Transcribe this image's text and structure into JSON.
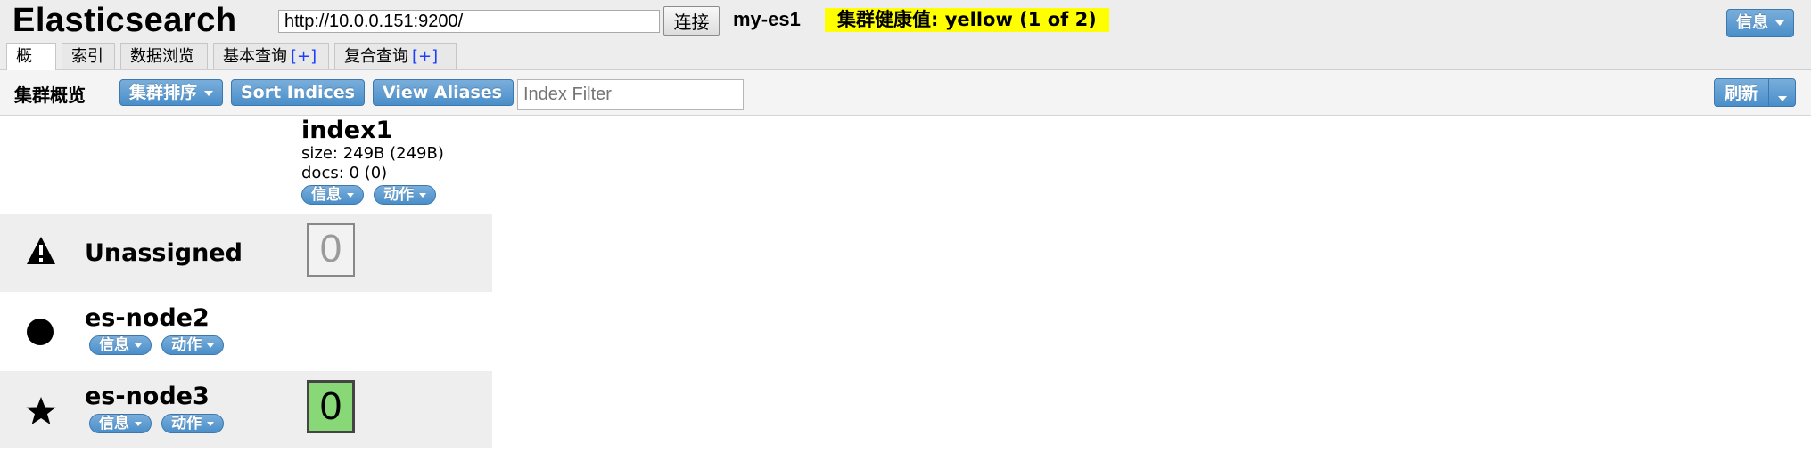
{
  "header": {
    "app_title": "Elasticsearch",
    "url_value": "http://10.0.0.151:9200/",
    "connect_label": "连接",
    "cluster_name": "my-es1",
    "health_text": "集群健康值: yellow (1 of 2)",
    "info_label": "信息"
  },
  "tabs": [
    {
      "label": "概览",
      "active": true
    },
    {
      "label": "索引",
      "active": false
    },
    {
      "label": "数据浏览",
      "active": false
    },
    {
      "label": "基本查询",
      "plus": "[+]",
      "active": false
    },
    {
      "label": "复合查询",
      "plus": "[+]",
      "active": false
    }
  ],
  "toolbar": {
    "title": "集群概览",
    "cluster_sort_label": "集群排序",
    "sort_indices_label": "Sort Indices",
    "view_aliases_label": "View Aliases",
    "index_filter_placeholder": "Index Filter",
    "refresh_label": "刷新"
  },
  "index": {
    "name": "index1",
    "size": "size: 249B (249B)",
    "docs": "docs: 0 (0)",
    "info_label": "信息",
    "action_label": "动作"
  },
  "rows": [
    {
      "name": "Unassigned",
      "icon": "warning-icon",
      "shard": "0"
    },
    {
      "name": "es-node2",
      "icon": "circle-icon",
      "info_label": "信息",
      "action_label": "动作"
    },
    {
      "name": "es-node3",
      "icon": "star-icon",
      "info_label": "信息",
      "action_label": "动作",
      "shard": "0"
    }
  ],
  "colors": {
    "health": "#ffff00",
    "button": "#4a8ec9",
    "primary_shard": "#88d878"
  }
}
